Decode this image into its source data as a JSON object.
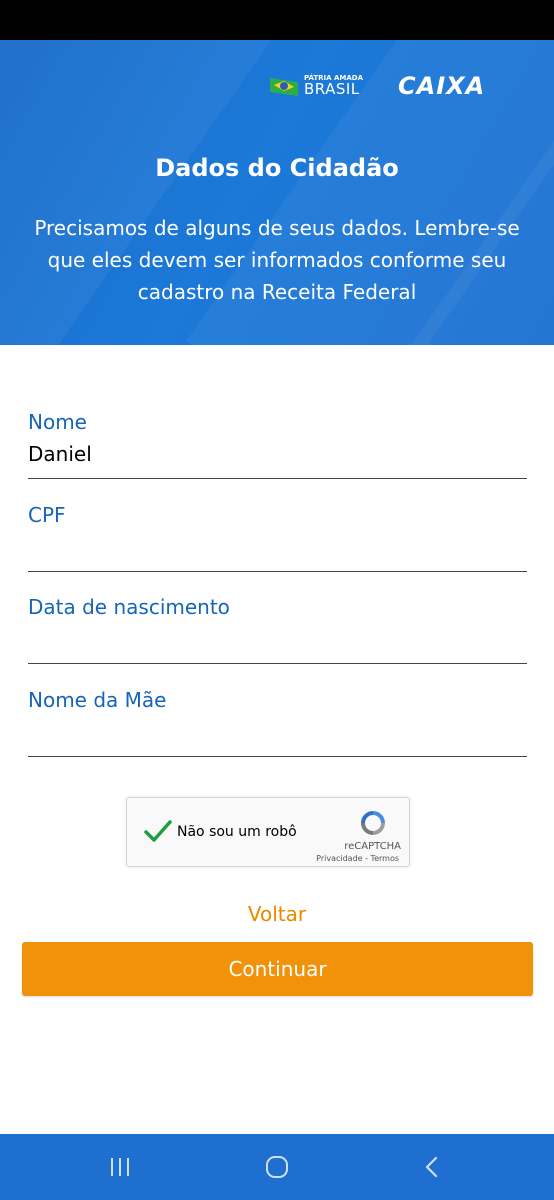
{
  "header": {
    "brasil_logo_small": "PÁTRIA AMADA",
    "brasil_logo_big": "BRASIL",
    "caixa_logo": "CAIXA",
    "title": "Dados do Cidadão",
    "subtitle": "Precisamos de alguns de seus dados. Lembre-se que eles devem ser informados conforme seu cadastro na Receita Federal"
  },
  "form": {
    "fields": [
      {
        "label": "Nome",
        "value": "Daniel"
      },
      {
        "label": "CPF",
        "value": ""
      },
      {
        "label": "Data de nascimento",
        "value": ""
      },
      {
        "label": "Nome da Mãe",
        "value": ""
      }
    ]
  },
  "captcha": {
    "label": "Não sou um robô",
    "brand": "reCAPTCHA",
    "links": "Privacidade - Termos",
    "checked": true
  },
  "actions": {
    "back_label": "Voltar",
    "continue_label": "Continuar"
  },
  "navbar": {
    "items": [
      "recent-apps-icon",
      "home-icon",
      "back-icon"
    ]
  },
  "colors": {
    "header_blue": "#1a73d1",
    "label_blue": "#1565b8",
    "accent_orange": "#f0920a",
    "check_green": "#1e9e3e"
  }
}
